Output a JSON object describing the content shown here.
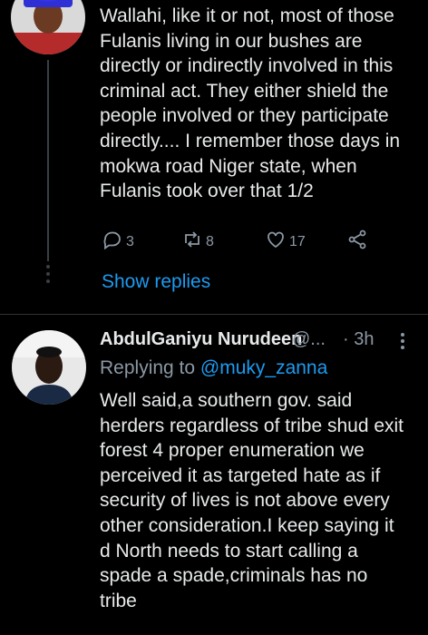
{
  "tweet_1": {
    "text": "Wallahi, like it or not, most of those\nFulanis living in our bushes are\ndirectly or indirectly involved in this\ncriminal act. They either shield the\npeople involved or they participate\ndirectly.... I remember those days in\nmokwa road Niger state, when\nFulanis took over that 1/2",
    "reply_count": "3",
    "retweet_count": "8",
    "like_count": "17",
    "show_replies_label": "Show replies"
  },
  "tweet_2": {
    "author_name": "AbdulGaniyu Nurudeen",
    "author_handle": "@...",
    "time": "· 3h",
    "replying_to_prefix": "Replying to",
    "replying_to_handle": "@muky_zanna",
    "text": "Well said,a southern gov. said\nherders regardless of tribe shud exit\nforest 4 proper enumeration we\nperceived it as targeted hate as if\nsecurity of lives is not above every\nother consideration.I keep saying it\nd North needs to start calling a\nspade a spade,criminals has no\ntribe"
  },
  "colors": {
    "background": "#000000",
    "text": "#e7e9ea",
    "secondary": "#8b98a5",
    "accent": "#1d9bf0",
    "divider": "#2f3336"
  },
  "icons": [
    "reply-icon",
    "retweet-icon",
    "like-icon",
    "share-icon",
    "more-options-icon"
  ]
}
